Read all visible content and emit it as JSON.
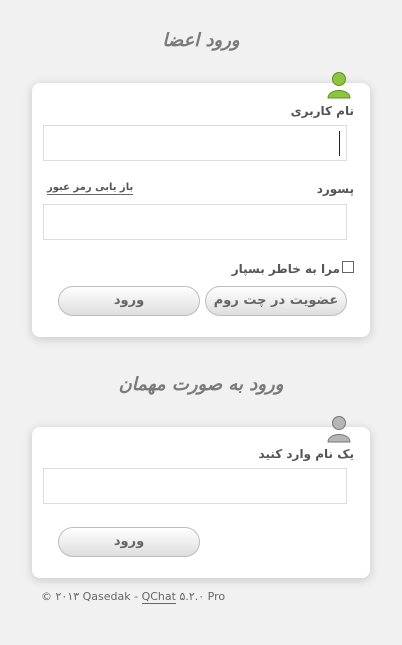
{
  "members": {
    "title": "ورود اعضا",
    "username_label": "نام کاربری",
    "username_value": "",
    "password_label": "پسورد",
    "forgot_link": "باز یابی رمز عبور",
    "password_value": "",
    "remember_label": "مرا به خاطر بسپار",
    "register_button": "عضویت در چت روم",
    "login_button": "ورود",
    "icon": "user-green-icon"
  },
  "guest": {
    "title": "ورود به صورت مهمان",
    "name_label": "یک نام وارد کنید",
    "name_value": "",
    "login_button": "ورود",
    "icon": "user-gray-icon"
  },
  "footer": {
    "copyright": "© ۲۰۱۳ Qasedak - ",
    "product": "QChat",
    "version": " ۵.۲.۰ Pro"
  },
  "colors": {
    "member_icon": "#8cc63f",
    "guest_icon": "#b5b5b5"
  }
}
